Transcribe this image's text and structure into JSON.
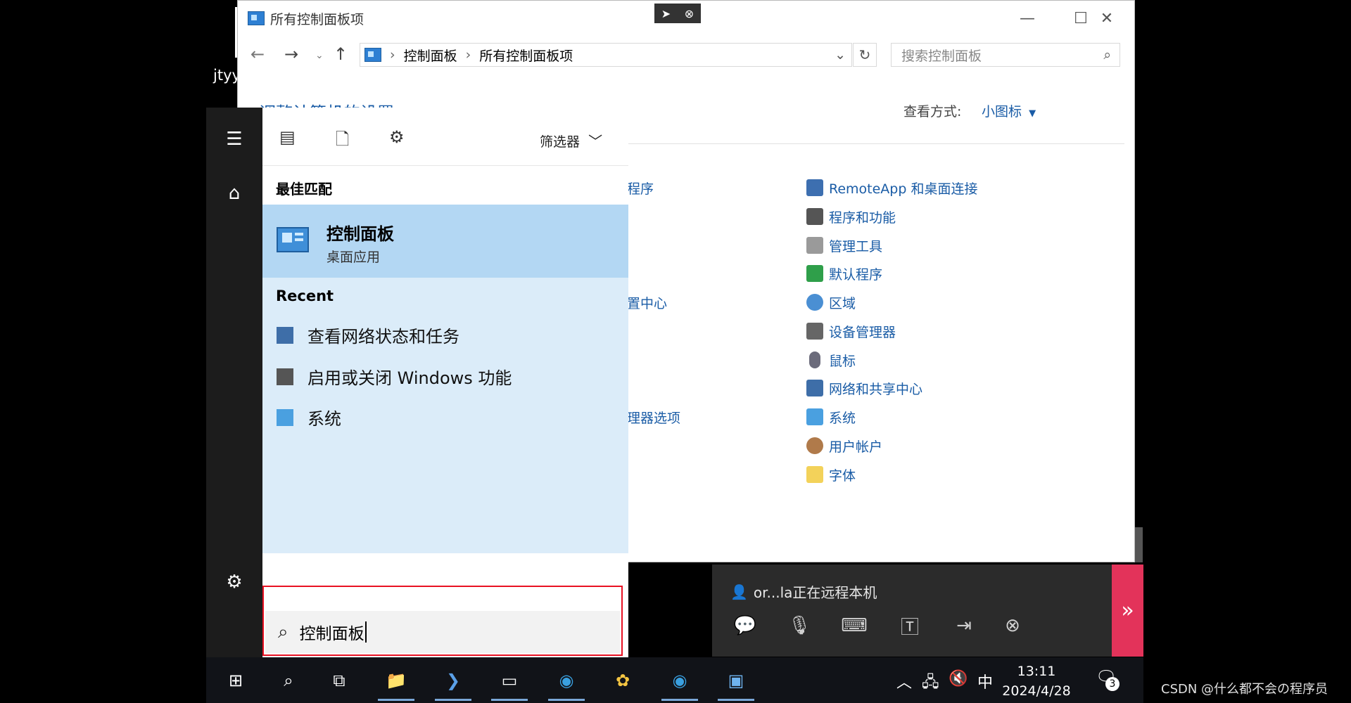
{
  "user_label": "jtyy",
  "control_panel": {
    "title": "所有控制面板项",
    "breadcrumb": [
      "控制面板",
      "所有控制面板项"
    ],
    "search_placeholder": "搜索控制面板",
    "partial_heading": "调整计算机的设置",
    "view_by_label": "查看方式:",
    "view_by_value": "小图标",
    "left_column_fragments": [
      "程序",
      "置中心",
      "理器选项"
    ],
    "right_column_items": [
      {
        "label": "RemoteApp 和桌面连接",
        "icon": "remoteapp-icon"
      },
      {
        "label": "程序和功能",
        "icon": "programs-icon"
      },
      {
        "label": "管理工具",
        "icon": "admin-tools-icon"
      },
      {
        "label": "默认程序",
        "icon": "default-programs-icon"
      },
      {
        "label": "区域",
        "icon": "region-icon"
      },
      {
        "label": "设备管理器",
        "icon": "device-manager-icon"
      },
      {
        "label": "鼠标",
        "icon": "mouse-icon"
      },
      {
        "label": "网络和共享中心",
        "icon": "network-icon"
      },
      {
        "label": "系统",
        "icon": "system-icon"
      },
      {
        "label": "用户帐户",
        "icon": "user-accounts-icon"
      },
      {
        "label": "字体",
        "icon": "fonts-icon"
      }
    ]
  },
  "start_menu": {
    "filter_label": "筛选器",
    "best_match_heading": "最佳匹配",
    "best_match_title": "控制面板",
    "best_match_subtitle": "桌面应用",
    "recent_heading": "Recent",
    "recent_items": [
      "查看网络状态和任务",
      "启用或关闭 Windows 功能",
      "系统"
    ],
    "search_value": "控制面板"
  },
  "remote_bar": {
    "status": "or...la正在远程本机"
  },
  "taskbar": {
    "time": "13:11",
    "date": "2024/4/28",
    "ime": "中",
    "notification_count": "3"
  },
  "watermark": "CSDN @什么都不会の程序员"
}
